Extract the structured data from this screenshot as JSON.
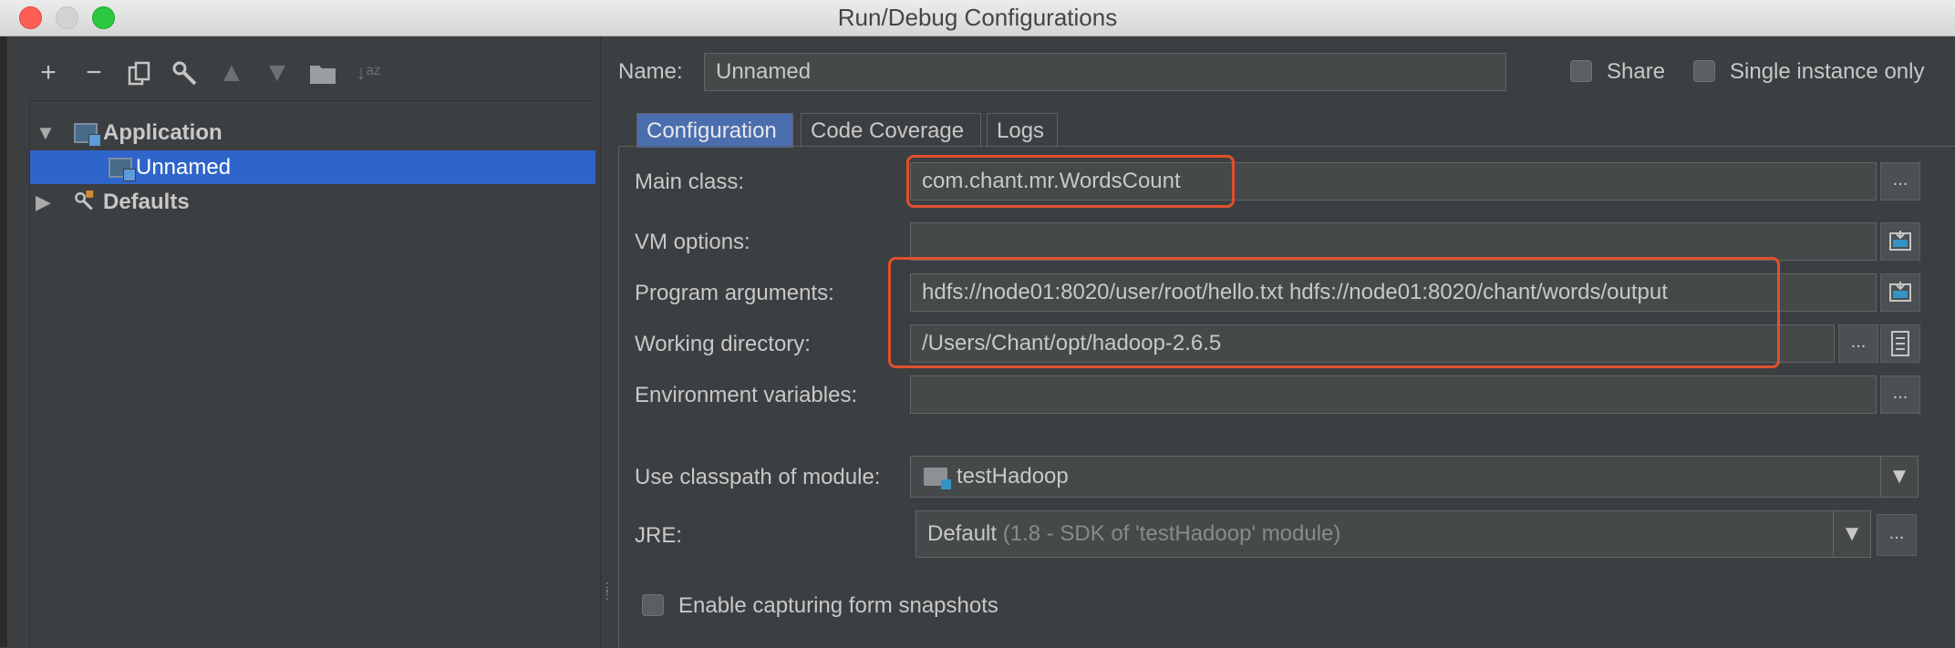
{
  "window": {
    "title": "Run/Debug Configurations"
  },
  "toolbar": {
    "icons": [
      "add-icon",
      "remove-icon",
      "copy-icon",
      "edit-defaults-icon",
      "move-up-icon",
      "move-down-icon",
      "folder-icon",
      "sort-icon"
    ]
  },
  "tree": {
    "items": [
      {
        "label": "Application",
        "expanded": true
      },
      {
        "label": "Unnamed",
        "selected": true
      },
      {
        "label": "Defaults",
        "expanded": false
      }
    ]
  },
  "header": {
    "name_label": "Name:",
    "name_value": "Unnamed",
    "share_label": "Share",
    "single_instance_label": "Single instance only"
  },
  "tabs": [
    {
      "label": "Configuration",
      "active": true
    },
    {
      "label": "Code Coverage",
      "active": false
    },
    {
      "label": "Logs",
      "active": false
    }
  ],
  "form": {
    "main_class_label": "Main class:",
    "main_class_value": "com.chant.mr.WordsCount",
    "vm_options_label": "VM options:",
    "vm_options_value": "",
    "program_args_label": "Program arguments:",
    "program_args_value": "hdfs://node01:8020/user/root/hello.txt hdfs://node01:8020/chant/words/output",
    "working_dir_label": "Working directory:",
    "working_dir_value": "/Users/Chant/opt/hadoop-2.6.5",
    "env_vars_label": "Environment variables:",
    "env_vars_value": "",
    "classpath_label": "Use classpath of module:",
    "classpath_value": "testHadoop",
    "jre_label": "JRE:",
    "jre_value": "Default",
    "jre_detail": "(1.8 - SDK of 'testHadoop' module)",
    "snapshots_label": "Enable capturing form snapshots",
    "ellipsis": "...",
    "dropdown_arrow": "▼"
  },
  "colors": {
    "highlight": "#e0502d",
    "selection": "#2f65ca",
    "active_tab": "#4b6eaf"
  }
}
